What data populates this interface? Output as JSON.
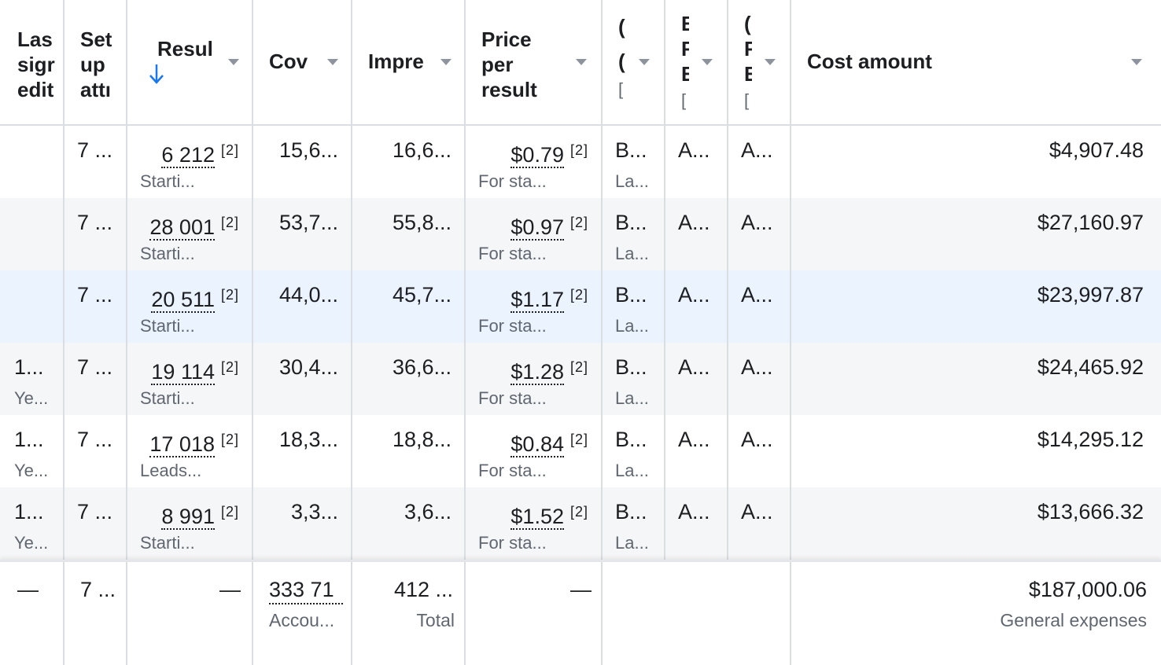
{
  "headers": {
    "c1_lines": [
      "Las",
      "sigr",
      "edit"
    ],
    "c2_lines": [
      "Set",
      "up",
      "attı"
    ],
    "c3": "Resul",
    "c4": "Cov",
    "c5": "Impre",
    "c6_lines": [
      "Price",
      "per",
      "result"
    ],
    "c7_lines": [
      "(",
      "(",
      "["
    ],
    "c8_lines": [
      "E",
      "F",
      "E",
      "["
    ],
    "c9_lines": [
      "(",
      "F",
      "E",
      "["
    ],
    "c10": "Cost amount",
    "sort_icon": "arrow-down-icon",
    "caret_icon": "caret-down-icon",
    "accent_color": "#1877f2"
  },
  "rows": [
    {
      "last": "",
      "last_sub": "",
      "setup": "7 ...",
      "results": "6 212",
      "results_fn": "[2]",
      "results_sub": "Starti...",
      "coverage": "15,6...",
      "impressions": "16,6...",
      "price": "$0.79",
      "price_fn": "[2]",
      "price_sub": "For sta...",
      "c7": "B...",
      "c7_sub": "La...",
      "c8": "A...",
      "c9": "A...",
      "cost": "$4,907.48",
      "style": "normal"
    },
    {
      "last": "",
      "last_sub": "",
      "setup": "7 ...",
      "results": "28 001",
      "results_fn": "[2]",
      "results_sub": "Starti...",
      "coverage": "53,7...",
      "impressions": "55,8...",
      "price": "$0.97",
      "price_fn": "[2]",
      "price_sub": "For sta...",
      "c7": "B...",
      "c7_sub": "La...",
      "c8": "A...",
      "c9": "A...",
      "cost": "$27,160.97",
      "style": "alt"
    },
    {
      "last": "",
      "last_sub": "",
      "setup": "7 ...",
      "results": "20 511",
      "results_fn": "[2]",
      "results_sub": "Starti...",
      "coverage": "44,0...",
      "impressions": "45,7...",
      "price": "$1.17",
      "price_fn": "[2]",
      "price_sub": "For sta...",
      "c7": "B...",
      "c7_sub": "La...",
      "c8": "A...",
      "c9": "A...",
      "cost": "$23,997.87",
      "style": "hl"
    },
    {
      "last": "1...",
      "last_sub": "Ye...",
      "setup": "7 ...",
      "results": "19 114",
      "results_fn": "[2]",
      "results_sub": "Starti...",
      "coverage": "30,4...",
      "impressions": "36,6...",
      "price": "$1.28",
      "price_fn": "[2]",
      "price_sub": "For sta...",
      "c7": "B...",
      "c7_sub": "La...",
      "c8": "A...",
      "c9": "A...",
      "cost": "$24,465.92",
      "style": "alt"
    },
    {
      "last": "1...",
      "last_sub": "Ye...",
      "setup": "7 ...",
      "results": "17 018",
      "results_fn": "[2]",
      "results_sub": "Leads...",
      "coverage": "18,3...",
      "impressions": "18,8...",
      "price": "$0.84",
      "price_fn": "[2]",
      "price_sub": "For sta...",
      "c7": "B...",
      "c7_sub": "La...",
      "c8": "A...",
      "c9": "A...",
      "cost": "$14,295.12",
      "style": "normal"
    },
    {
      "last": "1...",
      "last_sub": "Ye...",
      "setup": "7 ...",
      "results": "8 991",
      "results_fn": "[2]",
      "results_sub": "Starti...",
      "coverage": "3,3...",
      "impressions": "3,6...",
      "price": "$1.52",
      "price_fn": "[2]",
      "price_sub": "For sta...",
      "c7": "B...",
      "c7_sub": "La...",
      "c8": "A...",
      "c9": "A...",
      "cost": "$13,666.32",
      "style": "alt"
    }
  ],
  "footer": {
    "last": "—",
    "setup": "7 ...",
    "results": "—",
    "coverage": "333 71",
    "coverage_sub": "Accou...",
    "impressions": "412 ...",
    "impressions_sub": "Total",
    "price": "—",
    "cost": "$187,000.06",
    "cost_sub": "General expenses"
  }
}
